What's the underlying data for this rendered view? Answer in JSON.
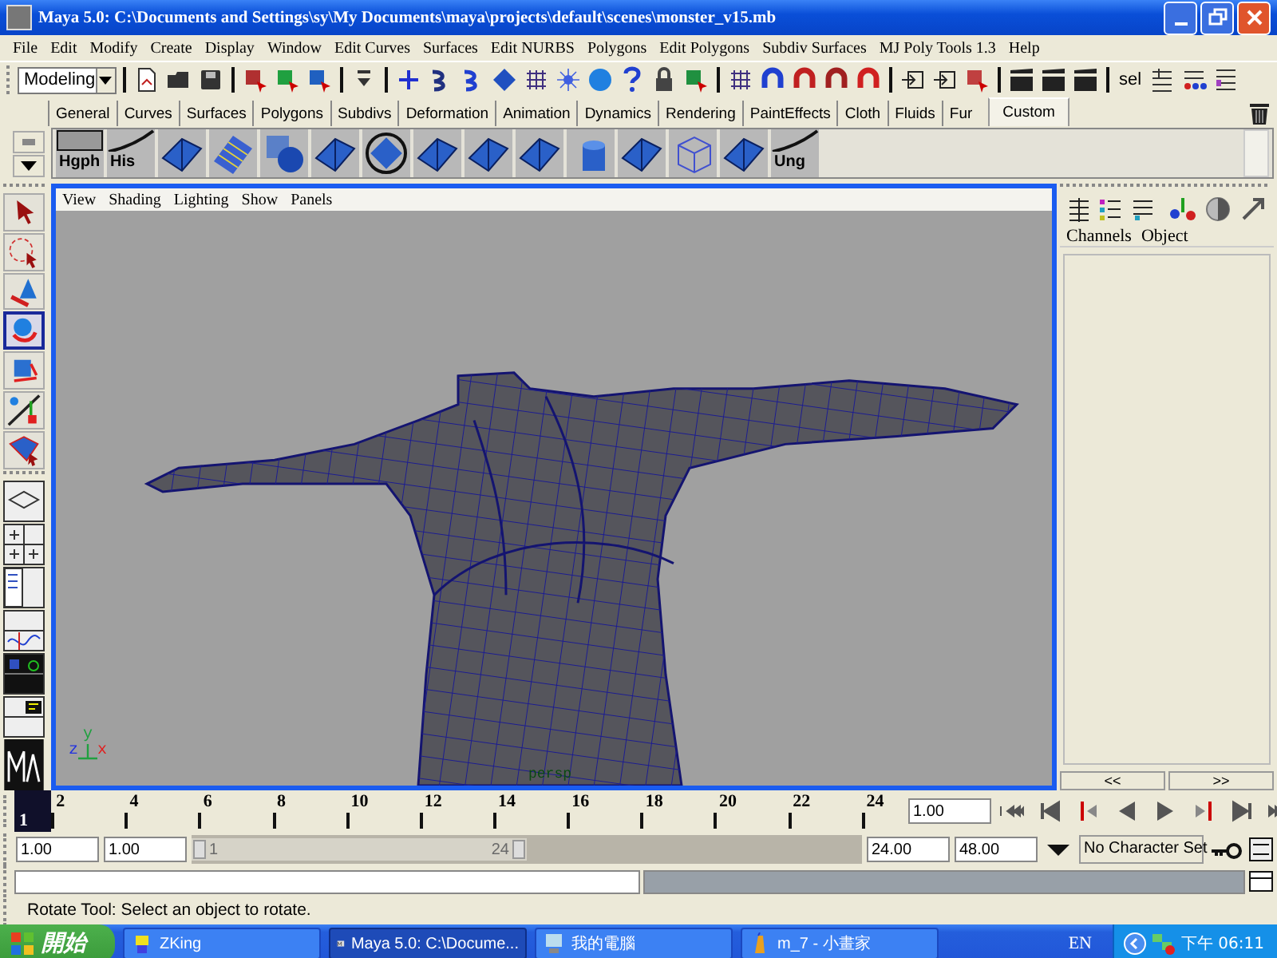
{
  "window": {
    "title": "Maya 5.0: C:\\Documents and Settings\\sy\\My Documents\\maya\\projects\\default\\scenes\\monster_v15.mb"
  },
  "menu": [
    "File",
    "Edit",
    "Modify",
    "Create",
    "Display",
    "Window",
    "Edit Curves",
    "Surfaces",
    "Edit NURBS",
    "Polygons",
    "Edit Polygons",
    "Subdiv Surfaces",
    "MJ Poly Tools 1.3",
    "Help"
  ],
  "status_line": {
    "menu_set": "Modeling",
    "sel_label": "sel"
  },
  "shelf_tabs": [
    {
      "label": "General",
      "selected": false
    },
    {
      "label": "Curves",
      "selected": false
    },
    {
      "label": "Surfaces",
      "selected": false
    },
    {
      "label": "Polygons",
      "selected": false
    },
    {
      "label": "Subdivs",
      "selected": false
    },
    {
      "label": "Deformation",
      "selected": false
    },
    {
      "label": "Animation",
      "selected": false
    },
    {
      "label": "Dynamics",
      "selected": false
    },
    {
      "label": "Rendering",
      "selected": false
    },
    {
      "label": "PaintEffects",
      "selected": false
    },
    {
      "label": "Cloth",
      "selected": false
    },
    {
      "label": "Fluids",
      "selected": false
    },
    {
      "label": "Fur",
      "selected": false
    },
    {
      "label": "Custom",
      "selected": true
    }
  ],
  "shelf": {
    "lead_labels": [
      "Hgph",
      "His"
    ],
    "tail_label": "Ung"
  },
  "tools": [
    {
      "kind": "select",
      "selected": false
    },
    {
      "kind": "lasso",
      "selected": false
    },
    {
      "kind": "move",
      "selected": false
    },
    {
      "kind": "rotate",
      "selected": true
    },
    {
      "kind": "scale",
      "selected": false
    },
    {
      "kind": "manip",
      "selected": false
    },
    {
      "kind": "last",
      "selected": false
    }
  ],
  "viewport": {
    "menu": [
      "View",
      "Shading",
      "Lighting",
      "Show",
      "Panels"
    ],
    "camera": "persp",
    "axes": [
      "y",
      "z",
      "x"
    ]
  },
  "channel_box": {
    "menu": [
      "Channels",
      "Object"
    ],
    "buttons": [
      "<<",
      ">>"
    ]
  },
  "time_slider": {
    "ticks": [
      "2",
      "4",
      "6",
      "8",
      "10",
      "12",
      "14",
      "16",
      "18",
      "20",
      "22",
      "24"
    ],
    "current_frame": "1",
    "current_time": "1.00",
    "level": 0
  },
  "range_slider": {
    "start": "1.00",
    "inner_start": "1.00",
    "handle_start": "1",
    "handle_end": "24",
    "level": 0.5,
    "inner_end": "24.00",
    "end": "48.00",
    "character_set": "No Character Set"
  },
  "help_line": "Rotate Tool: Select an object to rotate.",
  "taskbar": {
    "start": "開始",
    "items": [
      {
        "label": "ZKing",
        "selected": false
      },
      {
        "label": "Maya 5.0: C:\\Docume...",
        "selected": true
      },
      {
        "label": "我的電腦",
        "selected": false
      },
      {
        "label": "m_7 - 小畫家",
        "selected": false
      }
    ],
    "language": "EN",
    "clock": "下午 06:11"
  }
}
